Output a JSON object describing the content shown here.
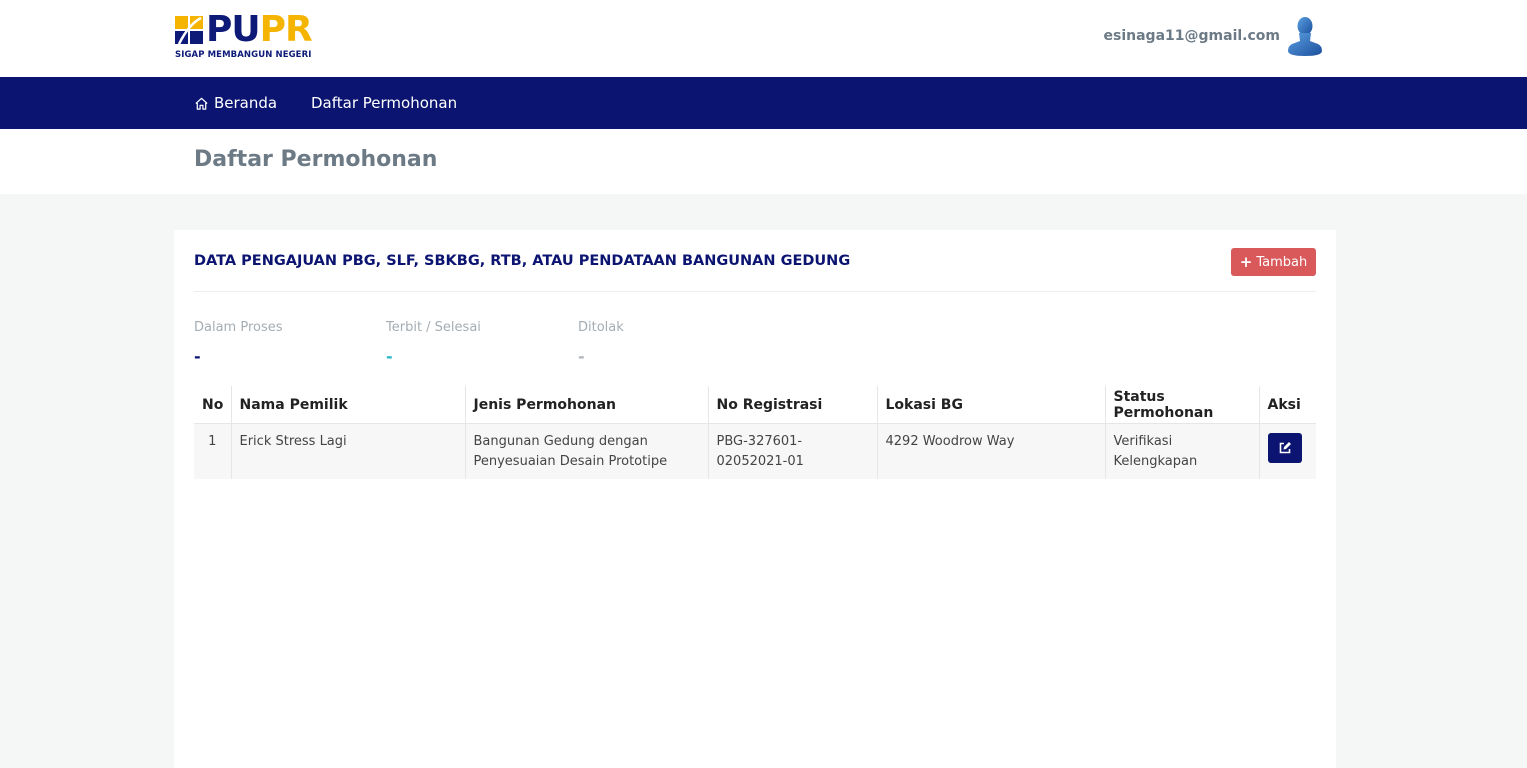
{
  "brand": {
    "logo_text_blue": "PU",
    "logo_text_yellow": "PR",
    "tagline": "SIGAP MEMBANGUN NEGERI",
    "colors": {
      "navy": "#0b1470",
      "yellow": "#f5b400",
      "danger": "#d9595b",
      "teal": "#29b6c9"
    }
  },
  "user": {
    "email": "esinaga11@gmail.com",
    "avatar_icon": "user-avatar-icon"
  },
  "nav": {
    "home_icon": "home-icon",
    "home_label": "Beranda",
    "list_label": "Daftar Permohonan"
  },
  "page": {
    "title": "Daftar Permohonan"
  },
  "card": {
    "title": "DATA PENGAJUAN PBG, SLF, SBKBG, RTB, ATAU PENDATAAN BANGUNAN GEDUNG",
    "add_button": {
      "icon": "plus-icon",
      "label": "Tambah"
    }
  },
  "stats": [
    {
      "label": "Dalam Proses",
      "value": "-"
    },
    {
      "label": "Terbit / Selesai",
      "value": "-"
    },
    {
      "label": "Ditolak",
      "value": "-"
    }
  ],
  "table": {
    "columns": [
      "No",
      "Nama Pemilik",
      "Jenis Permohonan",
      "No Registrasi",
      "Lokasi BG",
      "Status Permohonan",
      "Aksi"
    ],
    "rows": [
      {
        "no": "1",
        "nama_pemilik": "Erick Stress Lagi",
        "jenis_permohonan": "Bangunan Gedung dengan Penyesuaian Desain Prototipe",
        "no_registrasi": "PBG-327601-02052021-01",
        "lokasi_bg": "4292 Woodrow Way",
        "status": "Verifikasi Kelengkapan",
        "action_icon": "edit-icon"
      }
    ]
  }
}
